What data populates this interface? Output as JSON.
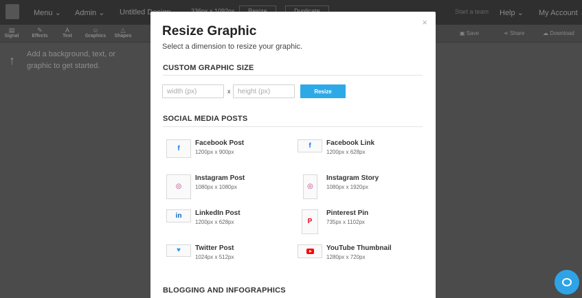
{
  "app": {
    "menu": "Menu",
    "admin": "Admin",
    "doc_title": "Untitled Design",
    "size_display": "336px x 1092px",
    "resize_btn": "Resize",
    "duplicate_btn": "Duplicate",
    "start_team": "Start a team",
    "help": "Help",
    "account": "My Account",
    "tools": [
      "Signal",
      "Effects",
      "Text",
      "Graphics",
      "Shapes"
    ],
    "save": "Save",
    "share": "Share",
    "download": "Download",
    "tip": "Add a background, text, or graphic to get started."
  },
  "modal": {
    "title": "Resize Graphic",
    "subtitle": "Select a dimension to resize your graphic.",
    "close": "×",
    "custom": {
      "heading": "CUSTOM GRAPHIC SIZE",
      "width_placeholder": "width (px)",
      "height_placeholder": "height (px)",
      "times": "x",
      "button": "Resize"
    },
    "social": {
      "heading": "SOCIAL MEDIA POSTS",
      "items": [
        {
          "name": "Facebook Post",
          "dims": "1200px x 900px",
          "icon": "facebook-icon",
          "color": "#1877f2"
        },
        {
          "name": "Facebook Link",
          "dims": "1200px x 628px",
          "icon": "facebook-icon",
          "color": "#1877f2"
        },
        {
          "name": "Instagram Post",
          "dims": "1080px x 1080px",
          "icon": "instagram-icon",
          "color": "#c13584"
        },
        {
          "name": "Instagram Story",
          "dims": "1080px x 1920px",
          "icon": "instagram-icon",
          "color": "#c13584"
        },
        {
          "name": "LinkedIn Post",
          "dims": "1200px x 628px",
          "icon": "linkedin-icon",
          "color": "#0a66c2"
        },
        {
          "name": "Pinterest Pin",
          "dims": "735px x 1102px",
          "icon": "pinterest-icon",
          "color": "#e60023"
        },
        {
          "name": "Twitter Post",
          "dims": "1024px x 512px",
          "icon": "twitter-icon",
          "color": "#1da1f2"
        },
        {
          "name": "YouTube Thumbnail",
          "dims": "1280px x 720px",
          "icon": "youtube-icon",
          "color": "#ff0000"
        }
      ]
    },
    "blogging": {
      "heading": "BLOGGING AND INFOGRAPHICS"
    }
  }
}
